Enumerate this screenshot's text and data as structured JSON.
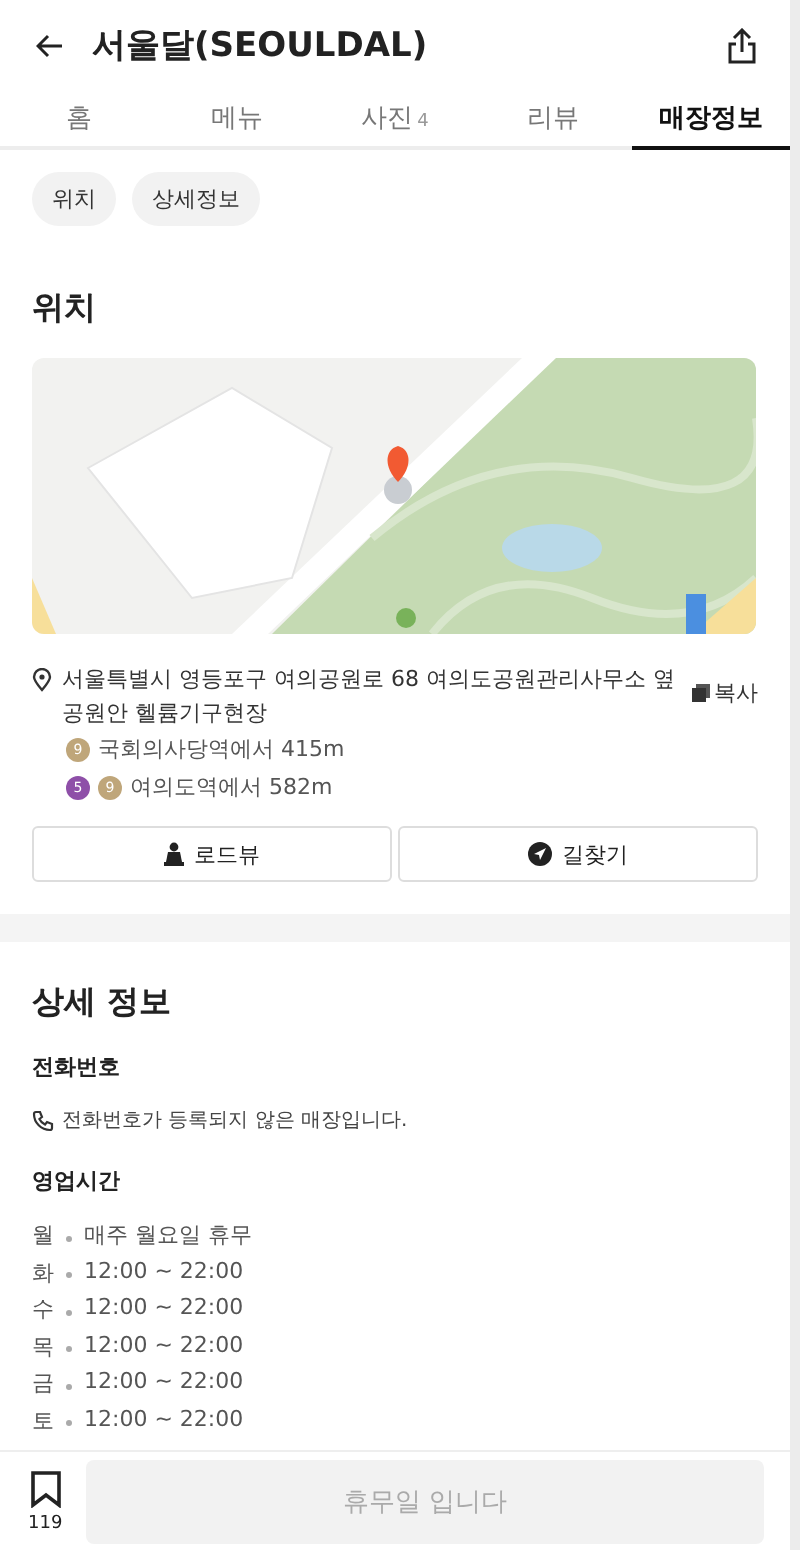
{
  "header": {
    "title": "서울달(SEOULDAL)"
  },
  "tabs": [
    {
      "label": "홈",
      "selected": false
    },
    {
      "label": "메뉴",
      "selected": false
    },
    {
      "label": "사진",
      "count": "4",
      "selected": false
    },
    {
      "label": "리뷰",
      "selected": false
    },
    {
      "label": "매장정보",
      "selected": true
    }
  ],
  "chips": [
    "위치",
    "상세정보"
  ],
  "location": {
    "title": "위치",
    "address": "서울특별시 영등포구 여의공원로 68 여의도공원관리사무소 옆 공원안 헬륨기구현장",
    "copy": "복사",
    "stations": [
      {
        "lines": [
          {
            "number": "9",
            "color": "#bfa67a"
          }
        ],
        "text": "국회의사당역에서 415m"
      },
      {
        "lines": [
          {
            "number": "5",
            "color": "#8e4fa8"
          },
          {
            "number": "9",
            "color": "#bfa67a"
          }
        ],
        "text": "여의도역에서 582m"
      }
    ],
    "buttons": [
      "로드뷰",
      "길찾기"
    ]
  },
  "details": {
    "title": "상세 정보",
    "phone_label": "전화번호",
    "phone": "전화번호가 등록되지 않은 매장입니다.",
    "hours_label": "영업시간",
    "hours": [
      {
        "day": "월",
        "time": "매주 월요일 휴무"
      },
      {
        "day": "화",
        "time": "12:00 ~ 22:00"
      },
      {
        "day": "수",
        "time": "12:00 ~ 22:00"
      },
      {
        "day": "목",
        "time": "12:00 ~ 22:00"
      },
      {
        "day": "금",
        "time": "12:00 ~ 22:00"
      },
      {
        "day": "토",
        "time": "12:00 ~ 22:00"
      }
    ]
  },
  "bottom": {
    "bookmarks": "119",
    "action": "휴무일 입니다",
    "disabled": true
  }
}
